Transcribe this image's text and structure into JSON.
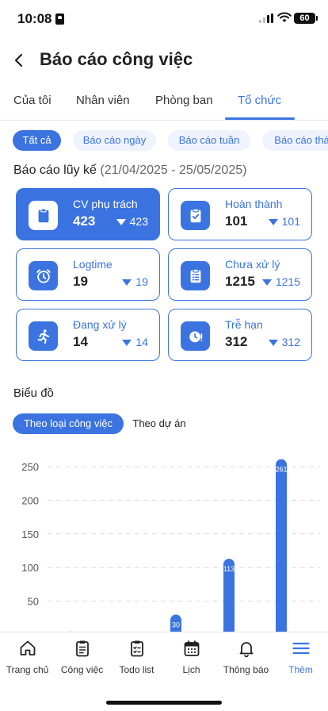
{
  "status_bar": {
    "time": "10:08",
    "battery": "60"
  },
  "header": {
    "title": "Báo cáo công việc"
  },
  "tabs": [
    {
      "label": "Của tôi"
    },
    {
      "label": "Nhân viên"
    },
    {
      "label": "Phòng ban"
    },
    {
      "label": "Tổ chức"
    }
  ],
  "active_tab": "Tổ chức",
  "filters": [
    {
      "label": "Tất cả"
    },
    {
      "label": "Báo cáo ngày"
    },
    {
      "label": "Báo cáo tuần"
    },
    {
      "label": "Báo cáo thá"
    }
  ],
  "active_filter": "Tất cả",
  "summary": {
    "title": "Báo cáo lũy kế",
    "range": "(21/04/2025 - 25/05/2025)",
    "cards": [
      {
        "label": "CV phụ trách",
        "value": "423",
        "delta": "423",
        "icon": "clipboard-icon"
      },
      {
        "label": "Hoàn thành",
        "value": "101",
        "delta": "101",
        "icon": "clipboard-check-icon"
      },
      {
        "label": "Logtime",
        "value": "19",
        "delta": "19",
        "icon": "alarm-clock-icon"
      },
      {
        "label": "Chưa xử lý",
        "value": "1215",
        "delta": "1215",
        "icon": "clipboard-list-icon"
      },
      {
        "label": "Đang xử lý",
        "value": "14",
        "delta": "14",
        "icon": "running-person-icon"
      },
      {
        "label": "Trễ hạn",
        "value": "312",
        "delta": "312",
        "icon": "clock-alert-icon"
      }
    ]
  },
  "chart_section": {
    "title": "Biểu đồ",
    "chips": [
      {
        "label": "Theo loại công việc"
      },
      {
        "label": "Theo dự án"
      }
    ],
    "active_chip": "Theo loại công việc"
  },
  "chart_data": {
    "type": "bar",
    "title": "",
    "xlabel": "",
    "ylabel": "",
    "ylim": [
      0,
      260
    ],
    "yticks": [
      50,
      100,
      150,
      200,
      250
    ],
    "categories": [
      "",
      "",
      "",
      "",
      ""
    ],
    "values": [
      5,
      30,
      113,
      261,
      0
    ],
    "data_labels": [
      "",
      "30",
      "113",
      "261",
      ""
    ],
    "grid": true,
    "legend": "none"
  },
  "bottom_nav": [
    {
      "label": "Trang chủ",
      "icon": "home-icon"
    },
    {
      "label": "Công việc",
      "icon": "clipboard-icon"
    },
    {
      "label": "Todo list",
      "icon": "checklist-icon"
    },
    {
      "label": "Lịch",
      "icon": "calendar-icon"
    },
    {
      "label": "Thông báo",
      "icon": "bell-icon"
    },
    {
      "label": "Thêm",
      "icon": "menu-icon"
    }
  ],
  "active_nav": "Thêm",
  "colors": {
    "accent": "#3B74E0",
    "accent_light": "#EEF3FD",
    "text": "#222222"
  }
}
